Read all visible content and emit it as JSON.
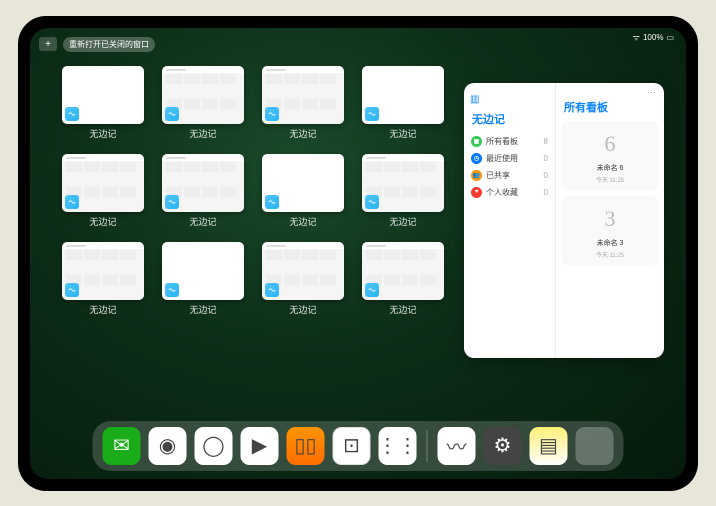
{
  "status": {
    "signal": "ᯤ",
    "battery": "100%",
    "batt_icon": "▭"
  },
  "topbar": {
    "plus": "+",
    "reopen_label": "重新打开已关闭的窗口"
  },
  "app_name": "无边记",
  "windows": [
    {
      "label": "无边记",
      "kind": "blank"
    },
    {
      "label": "无边记",
      "kind": "content"
    },
    {
      "label": "无边记",
      "kind": "content"
    },
    {
      "label": "无边记",
      "kind": "blank"
    },
    {
      "label": "无边记",
      "kind": "content"
    },
    {
      "label": "无边记",
      "kind": "content"
    },
    {
      "label": "无边记",
      "kind": "blank"
    },
    {
      "label": "无边记",
      "kind": "content"
    },
    {
      "label": "无边记",
      "kind": "content"
    },
    {
      "label": "无边记",
      "kind": "blank"
    },
    {
      "label": "无边记",
      "kind": "content"
    },
    {
      "label": "无边记",
      "kind": "content"
    }
  ],
  "panel": {
    "dots": "···",
    "left_title": "无边记",
    "right_title": "所有看板",
    "sidebar": [
      {
        "icon_class": "c1",
        "glyph": "▣",
        "label": "所有看板",
        "count": "8"
      },
      {
        "icon_class": "c2",
        "glyph": "◷",
        "label": "最近使用",
        "count": "0"
      },
      {
        "icon_class": "c3",
        "glyph": "👥",
        "label": "已共享",
        "count": "0"
      },
      {
        "icon_class": "c4",
        "glyph": "♥",
        "label": "个人收藏",
        "count": "0"
      }
    ],
    "boards": [
      {
        "sketch": "6",
        "name": "未命名 6",
        "date": "今天 11:25"
      },
      {
        "sketch": "3",
        "name": "未命名 3",
        "date": "今天 11:25"
      }
    ]
  },
  "dock": {
    "apps": [
      {
        "name": "wechat",
        "class": "di1",
        "glyph": "✉"
      },
      {
        "name": "quark",
        "class": "di2",
        "glyph": "◉"
      },
      {
        "name": "qq-browser",
        "class": "di3",
        "glyph": "◯"
      },
      {
        "name": "video",
        "class": "di4",
        "glyph": "▶"
      },
      {
        "name": "books",
        "class": "di5",
        "glyph": "▯▯"
      },
      {
        "name": "dice",
        "class": "di6",
        "glyph": "⊡"
      },
      {
        "name": "tools",
        "class": "di7",
        "glyph": "⋮⋮"
      }
    ],
    "recent": [
      {
        "name": "freeform",
        "class": "di8",
        "glyph": "〰"
      },
      {
        "name": "settings",
        "class": "di9",
        "glyph": "⚙"
      },
      {
        "name": "notes",
        "class": "di10",
        "glyph": "▤"
      }
    ]
  }
}
